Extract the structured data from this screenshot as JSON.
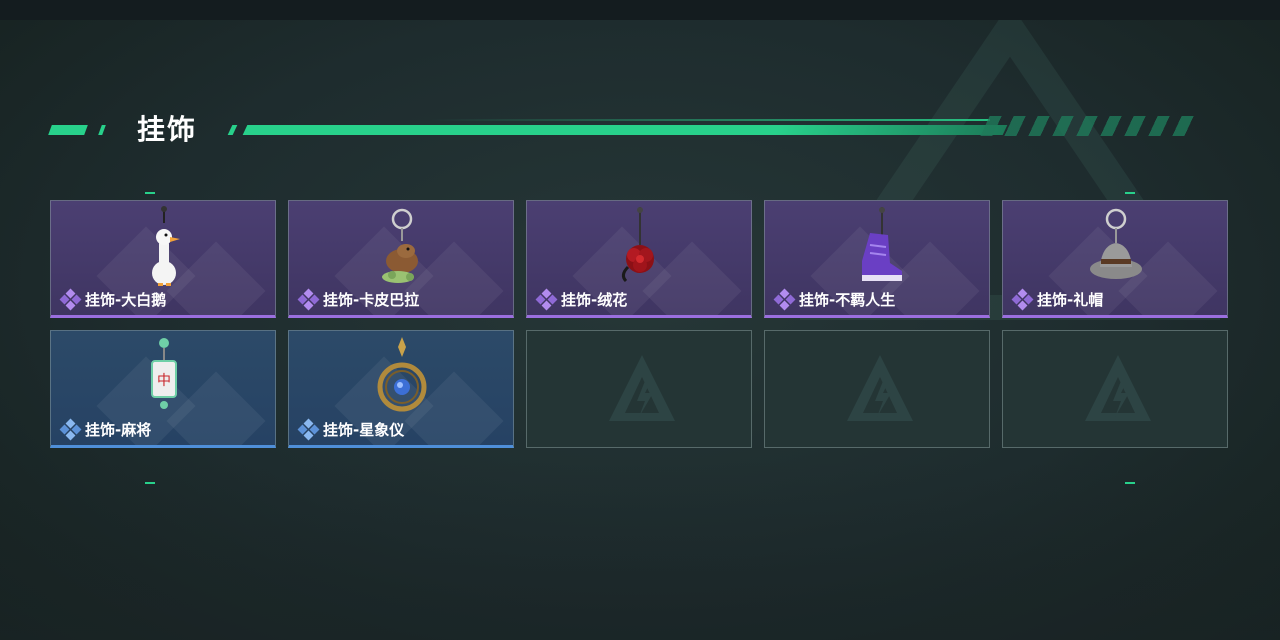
{
  "section": {
    "title": "挂饰"
  },
  "colors": {
    "accent_green": "#28d18b",
    "rarity_purple": "#9b6fdf",
    "rarity_blue": "#4f8fd9",
    "card_empty": "#243535"
  },
  "items": [
    {
      "label": "挂饰-大白鹅",
      "rarity": "purple",
      "icon": "goose-charm-icon"
    },
    {
      "label": "挂饰-卡皮巴拉",
      "rarity": "purple",
      "icon": "capybara-charm-icon"
    },
    {
      "label": "挂饰-绒花",
      "rarity": "purple",
      "icon": "velvet-flower-charm-icon"
    },
    {
      "label": "挂饰-不羁人生",
      "rarity": "purple",
      "icon": "sneaker-charm-icon"
    },
    {
      "label": "挂饰-礼帽",
      "rarity": "purple",
      "icon": "fedora-charm-icon"
    },
    {
      "label": "挂饰-麻将",
      "rarity": "blue",
      "icon": "mahjong-charm-icon"
    },
    {
      "label": "挂饰-星象仪",
      "rarity": "blue",
      "icon": "astrolabe-charm-icon"
    },
    {
      "label": "",
      "rarity": "empty",
      "icon": "empty-slot-logo-icon"
    },
    {
      "label": "",
      "rarity": "empty",
      "icon": "empty-slot-logo-icon"
    },
    {
      "label": "",
      "rarity": "empty",
      "icon": "empty-slot-logo-icon"
    }
  ]
}
